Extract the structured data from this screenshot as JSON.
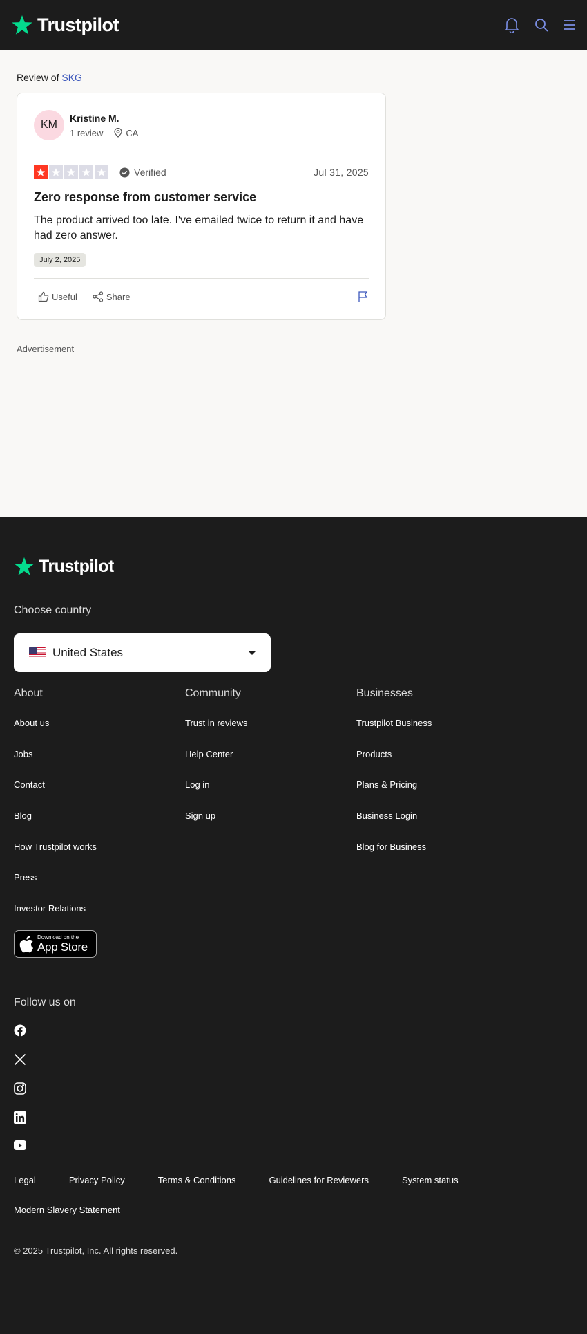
{
  "header": {
    "brand": "Trustpilot",
    "icons": [
      "bell-icon",
      "search-icon",
      "menu-icon"
    ]
  },
  "main": {
    "review_of_prefix": "Review of ",
    "company_link": "SKG",
    "review": {
      "author_initials": "KM",
      "author_name": "Kristine M.",
      "review_count": "1 review",
      "location": "CA",
      "rating": 1,
      "rating_max": 5,
      "verified_label": "Verified",
      "date": "Jul 31, 2025",
      "title": "Zero response from customer service",
      "body": "The product arrived too late. I've emailed twice to return it and have had zero answer.",
      "experience_date": "July 2, 2025",
      "useful_label": "Useful",
      "share_label": "Share"
    },
    "advertisement_label": "Advertisement"
  },
  "footer": {
    "brand": "Trustpilot",
    "choose_country": "Choose country",
    "selected_country": "United States",
    "columns": {
      "about": {
        "title": "About",
        "links": [
          "About us",
          "Jobs",
          "Contact",
          "Blog",
          "How Trustpilot works",
          "Press",
          "Investor Relations"
        ]
      },
      "community": {
        "title": "Community",
        "links": [
          "Trust in reviews",
          "Help Center",
          "Log in",
          "Sign up"
        ]
      },
      "businesses": {
        "title": "Businesses",
        "links": [
          "Trustpilot Business",
          "Products",
          "Plans & Pricing",
          "Business Login",
          "Blog for Business"
        ]
      }
    },
    "app_store": {
      "small": "Download on the",
      "big": "App Store"
    },
    "follow_us": "Follow us on",
    "socials": [
      "facebook-icon",
      "x-icon",
      "instagram-icon",
      "linkedin-icon",
      "youtube-icon"
    ],
    "legal_links": [
      "Legal",
      "Privacy Policy",
      "Terms & Conditions",
      "Guidelines for Reviewers",
      "System status",
      "Modern Slavery Statement"
    ],
    "copyright": "© 2025 Trustpilot, Inc. All rights reserved."
  },
  "colors": {
    "header_bg": "#1c1c1c",
    "brand_green": "#04da8d",
    "star_red": "#ff3722",
    "link_blue": "#3c57bc",
    "icon_blue": "#7b8fe6",
    "page_bg": "#f9f8f6"
  }
}
